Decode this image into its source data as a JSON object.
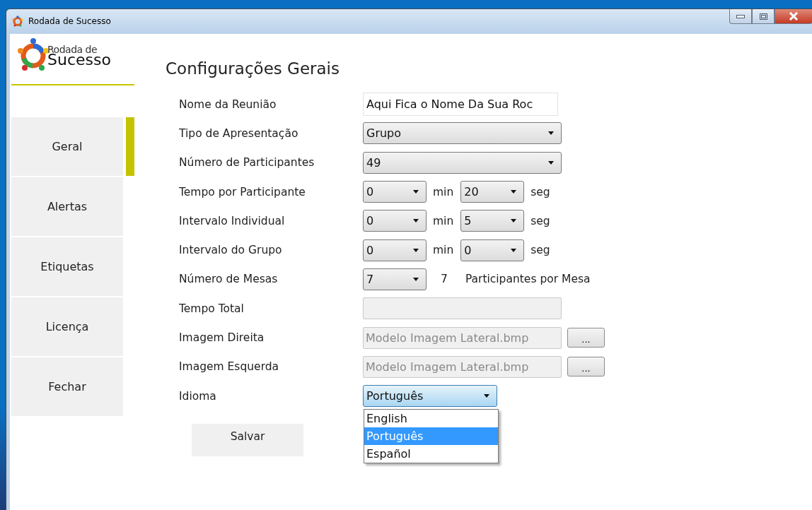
{
  "window": {
    "title": "Rodada de Sucesso"
  },
  "logo": {
    "line1": "Rodada de",
    "line2": "Sucesso"
  },
  "sidebar": {
    "items": [
      {
        "label": "Geral",
        "selected": true
      },
      {
        "label": "Alertas",
        "selected": false
      },
      {
        "label": "Etiquetas",
        "selected": false
      },
      {
        "label": "Licença",
        "selected": false
      },
      {
        "label": "Fechar",
        "selected": false
      }
    ]
  },
  "heading": "Configurações Gerais",
  "form": {
    "rows": [
      {
        "kind": "text",
        "label": "Nome da Reunião",
        "value": "Aqui Fica o Nome Da Sua Roc"
      },
      {
        "kind": "select",
        "label": "Tipo de Apresentação",
        "value": "Grupo"
      },
      {
        "kind": "select",
        "label": "Número de Participantes",
        "value": "49"
      },
      {
        "kind": "time",
        "label": "Tempo por Participante",
        "minutes": "0",
        "min_unit": "min",
        "seconds": "20",
        "sec_unit": "seg"
      },
      {
        "kind": "time",
        "label": "Intervalo Individual",
        "minutes": "0",
        "min_unit": "min",
        "seconds": "5",
        "sec_unit": "seg"
      },
      {
        "kind": "time",
        "label": "Intervalo do Grupo",
        "minutes": "0",
        "min_unit": "min",
        "seconds": "0",
        "sec_unit": "seg"
      },
      {
        "kind": "tables",
        "label": "Número de Mesas",
        "value": "7",
        "count": "7",
        "suffix": "Participantes por Mesa"
      },
      {
        "kind": "readonly",
        "label": "Tempo Total"
      },
      {
        "kind": "file",
        "label": "Imagem Direita",
        "value": "Modelo Imagem Lateral.bmp",
        "disabled": true,
        "button": "..."
      },
      {
        "kind": "file",
        "label": "Imagem Esquerda",
        "value": "Modelo Imagem Lateral.bmp",
        "disabled": true,
        "button": "..."
      },
      {
        "kind": "language",
        "label": "Idioma",
        "value": "Português",
        "expanded": true,
        "options": [
          {
            "label": "English",
            "selected": false
          },
          {
            "label": "Português",
            "selected": true
          },
          {
            "label": "Español",
            "selected": false
          }
        ]
      }
    ]
  },
  "save_button": "Salvar"
}
